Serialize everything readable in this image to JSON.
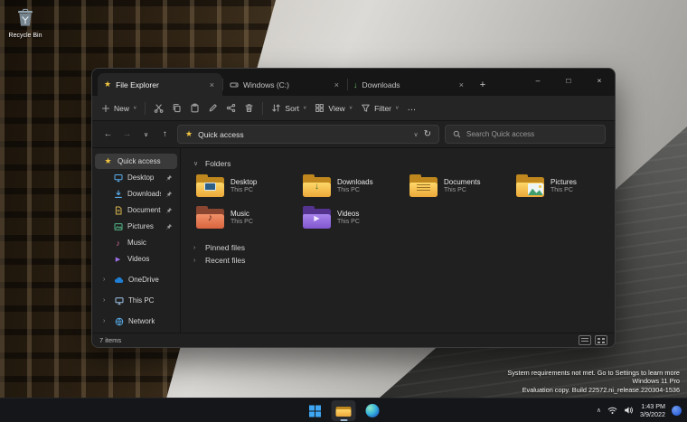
{
  "desktop": {
    "recycle_bin_label": "Recycle Bin"
  },
  "icons": {
    "star": "★",
    "close": "×",
    "minimize": "–",
    "maximize": "□",
    "new_tab": "+",
    "back": "←",
    "forward": "→",
    "up": "↑",
    "dropdown": "∨",
    "chevron_right": "›",
    "refresh": "↻",
    "more": "…",
    "download_arrow": "↓",
    "music_note": "♪",
    "play": "▶",
    "tray_chevron": "∧"
  },
  "explorer": {
    "tabs": [
      {
        "label": "File Explorer"
      },
      {
        "label": "Windows (C:)"
      },
      {
        "label": "Downloads"
      }
    ],
    "commandbar": {
      "new_label": "New",
      "sort_label": "Sort",
      "view_label": "View",
      "filter_label": "Filter"
    },
    "addressbar": {
      "location": "Quick access",
      "search_placeholder": "Search Quick access"
    },
    "sidebar": {
      "items": [
        {
          "label": "Quick access"
        },
        {
          "label": "Desktop"
        },
        {
          "label": "Downloads"
        },
        {
          "label": "Documents"
        },
        {
          "label": "Pictures"
        },
        {
          "label": "Music"
        },
        {
          "label": "Videos"
        },
        {
          "label": "OneDrive"
        },
        {
          "label": "This PC"
        },
        {
          "label": "Network"
        }
      ]
    },
    "content": {
      "folders_section": "Folders",
      "pinned_section": "Pinned files",
      "recent_section": "Recent files",
      "tiles": [
        {
          "name": "Desktop",
          "location": "This PC"
        },
        {
          "name": "Downloads",
          "location": "This PC"
        },
        {
          "name": "Documents",
          "location": "This PC"
        },
        {
          "name": "Pictures",
          "location": "This PC"
        },
        {
          "name": "Music",
          "location": "This PC"
        },
        {
          "name": "Videos",
          "location": "This PC"
        }
      ]
    },
    "statusbar": {
      "items_count": "7 items"
    }
  },
  "taskbar": {
    "clock": {
      "time": "1:43 PM",
      "date": "3/9/2022"
    }
  },
  "watermark": {
    "line1": "System requirements not met. Go to Settings to learn more",
    "line2": "Windows 11 Pro",
    "line3": "Evaluation copy. Build 22572.ni_release.220304-1536"
  }
}
